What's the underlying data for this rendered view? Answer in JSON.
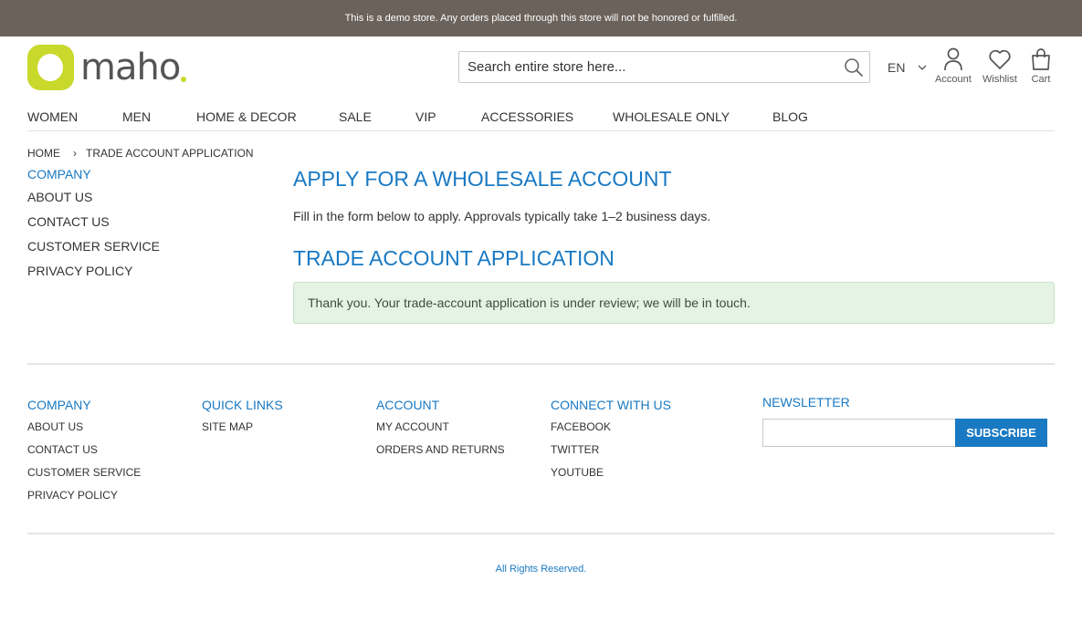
{
  "demo_notice": "This is a demo store. Any orders placed through this store will not be honored or fulfilled.",
  "brand": {
    "name": "maho",
    "accent": "#c8d92b",
    "link_color": "#1979c3"
  },
  "search": {
    "placeholder": "Search entire store here...",
    "icon": "search-icon"
  },
  "language": {
    "selected": "EN"
  },
  "header_icons": [
    {
      "label": "Account",
      "icon": "user-icon"
    },
    {
      "label": "Wishlist",
      "icon": "heart-icon"
    },
    {
      "label": "Cart",
      "icon": "shopping-bag-icon"
    }
  ],
  "nav": [
    "WOMEN",
    "MEN",
    "HOME & DECOR",
    "SALE",
    "VIP",
    "ACCESSORIES",
    "WHOLESALE ONLY",
    "BLOG"
  ],
  "breadcrumb": {
    "home": "HOME",
    "separator": "›",
    "current": "TRADE ACCOUNT APPLICATION"
  },
  "sidebar": {
    "title": "COMPANY",
    "links": [
      "ABOUT US",
      "CONTACT US",
      "CUSTOMER SERVICE",
      "PRIVACY POLICY"
    ]
  },
  "main": {
    "title": "APPLY FOR A WHOLESALE ACCOUNT",
    "intro": "Fill in the form below to apply. Approvals typically take 1–2 business days.",
    "subtitle": "TRADE ACCOUNT APPLICATION",
    "success_message": "Thank you. Your trade-account application is under review; we will be in touch."
  },
  "footer": {
    "columns": [
      {
        "title": "COMPANY",
        "links": [
          "ABOUT US",
          "CONTACT US",
          "CUSTOMER SERVICE",
          "PRIVACY POLICY"
        ]
      },
      {
        "title": "QUICK LINKS",
        "links": [
          "SITE MAP"
        ]
      },
      {
        "title": "ACCOUNT",
        "links": [
          "MY ACCOUNT",
          "ORDERS AND RETURNS"
        ]
      },
      {
        "title": "CONNECT WITH US",
        "links": [
          "FACEBOOK",
          "TWITTER",
          "YOUTUBE"
        ]
      }
    ],
    "newsletter": {
      "title": "NEWSLETTER",
      "button": "SUBSCRIBE",
      "value": ""
    },
    "rights": "All Rights Reserved."
  }
}
